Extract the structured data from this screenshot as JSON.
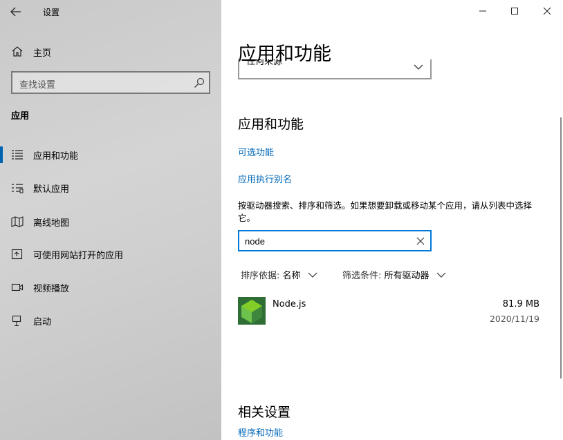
{
  "window": {
    "title": "设置"
  },
  "sidebar": {
    "home_label": "主页",
    "search_placeholder": "查找设置",
    "section_label": "应用",
    "items": [
      {
        "label": "应用和功能",
        "icon": "apps-list-icon",
        "active": true
      },
      {
        "label": "默认应用",
        "icon": "default-apps-icon"
      },
      {
        "label": "离线地图",
        "icon": "map-icon"
      },
      {
        "label": "可使用网站打开的应用",
        "icon": "open-in-app-icon"
      },
      {
        "label": "视频播放",
        "icon": "video-icon"
      },
      {
        "label": "启动",
        "icon": "startup-icon"
      }
    ]
  },
  "main": {
    "title": "应用和功能",
    "source_dropdown_value": "任何来源",
    "section_title": "应用和功能",
    "optional_features_link": "可选功能",
    "app_alias_link": "应用执行别名",
    "description": "按驱动器搜索、排序和筛选。如果想要卸载或移动某个应用，请从列表中选择它。",
    "filter_value": "node",
    "sort_label": "排序依据:",
    "sort_value": "名称",
    "filter_label": "筛选条件:",
    "filter_drive_value": "所有驱动器",
    "apps": [
      {
        "name": "Node.js",
        "size": "81.9 MB",
        "date": "2020/11/19"
      }
    ],
    "related_title": "相关设置",
    "related_link": "程序和功能"
  },
  "colors": {
    "accent": "#0078d7",
    "link": "#0067b8",
    "node_green": "#3c873a"
  }
}
